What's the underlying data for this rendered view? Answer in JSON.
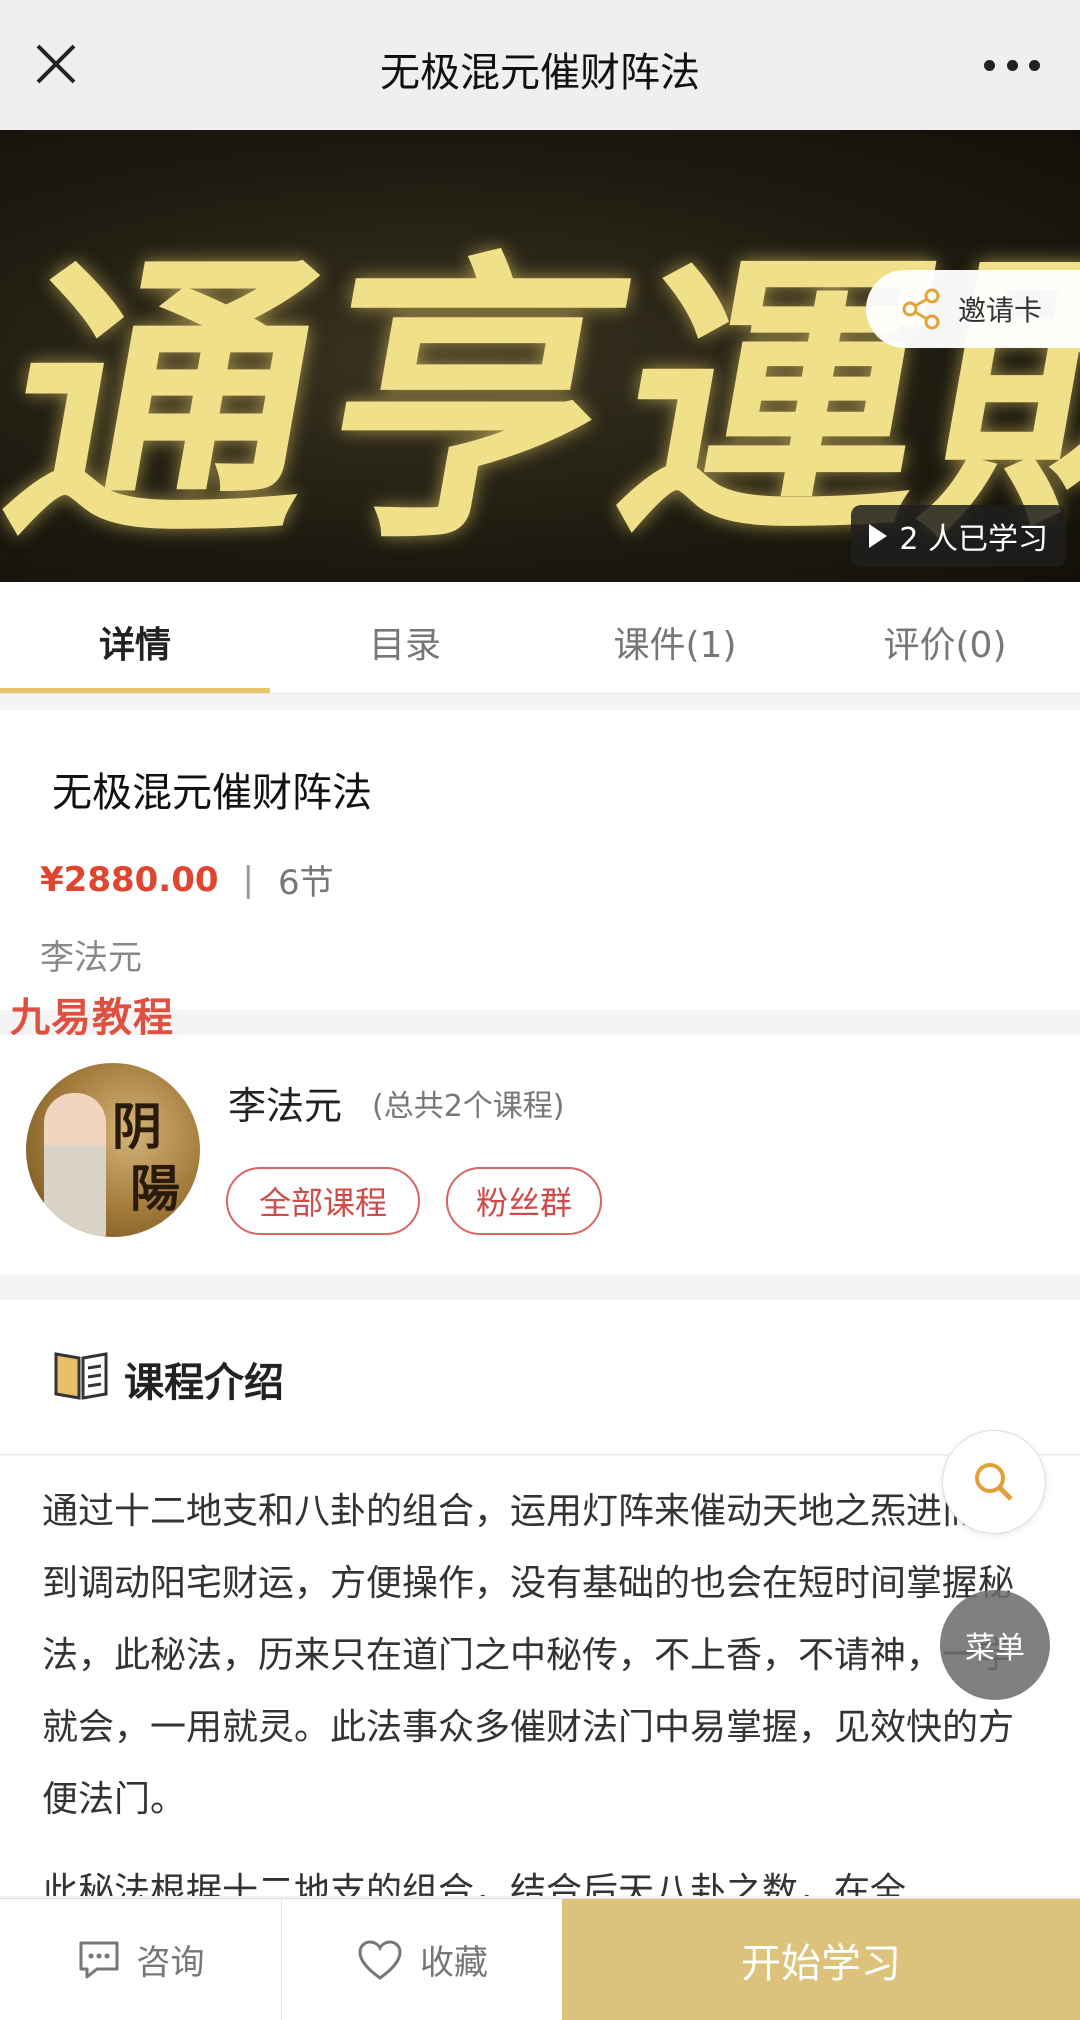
{
  "topbar": {
    "title": "无极混元催财阵法"
  },
  "banner": {
    "calligraphy": "通亨運財",
    "invite_label": "邀请卡",
    "learned_text": "2 人已学习"
  },
  "tabs": [
    {
      "label": "详情",
      "active": true
    },
    {
      "label": "目录",
      "active": false
    },
    {
      "label": "课件(1)",
      "active": false
    },
    {
      "label": "评价(0)",
      "active": false
    }
  ],
  "course": {
    "name": "无极混元催财阵法",
    "price": "¥2880.00",
    "separator": "|",
    "lessons": "6节",
    "author": "李法元"
  },
  "watermark": "九易教程",
  "teacher": {
    "name": "李法元",
    "course_count": "(总共2个课程)",
    "buttons": {
      "all_courses": "全部课程",
      "fans_group": "粉丝群"
    },
    "avatar_glyphs": [
      "阴",
      "陽"
    ]
  },
  "intro": {
    "heading": "课程介绍",
    "paragraph1": " 通过十二地支和八卦的组合，运用灯阵来催动天地之炁进而达到调动阳宅财运，方便操作，没有基础的也会在短时间掌握秘法，此秘法，历来只在道门之中秘传，不上香，不请神，一学就会，一用就灵。此法事众多催财法门中易掌握，见效快的方便法门。",
    "paragraph2": "  此秘法根据十二地支的组合，结合后天八卦之数，在全"
  },
  "floating": {
    "menu_label": "菜单"
  },
  "bottombar": {
    "consult": "咨询",
    "favorite": "收藏",
    "start": "开始学习"
  },
  "colors": {
    "accent": "#e9c66b",
    "price": "#e0452f",
    "pill": "#d04a4a",
    "start_button": "#dcc27a"
  }
}
